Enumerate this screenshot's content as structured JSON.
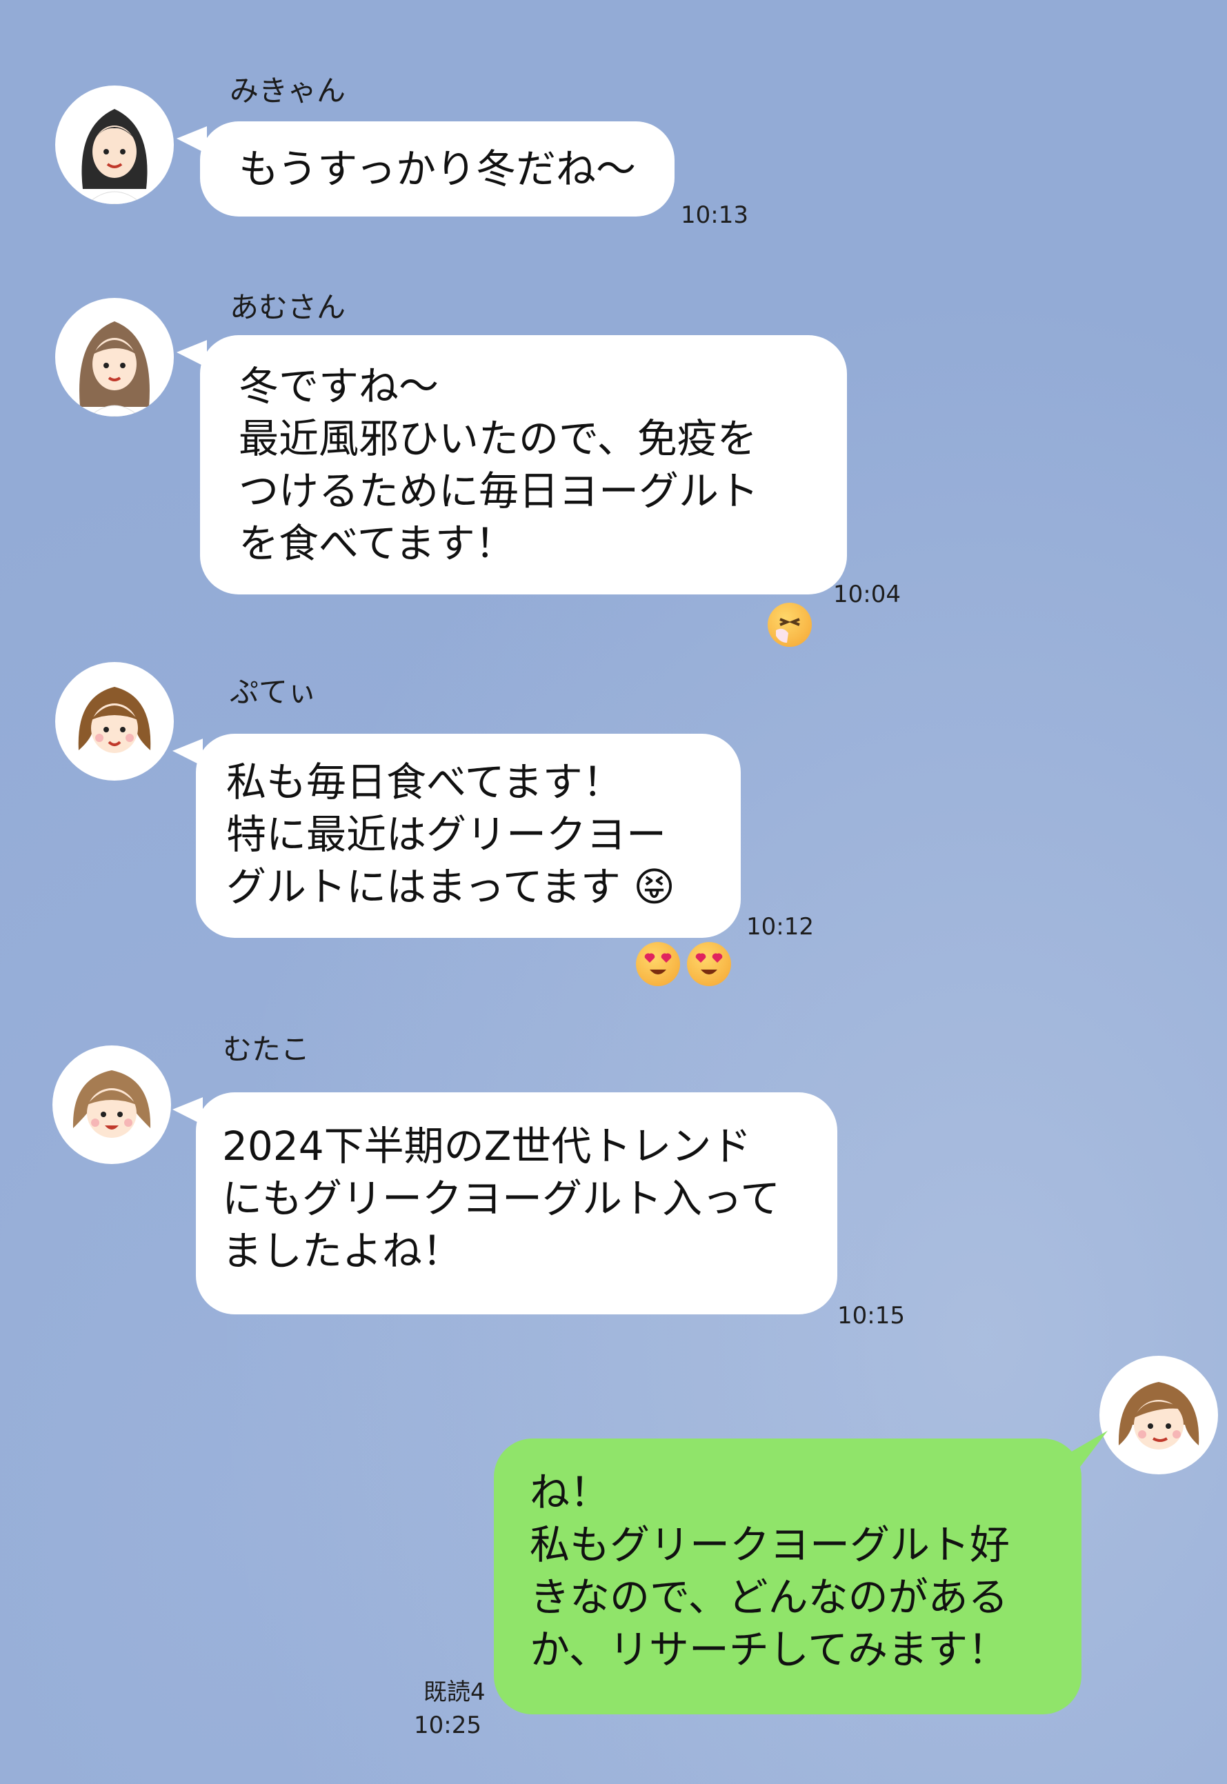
{
  "messages": [
    {
      "sender": "みきゃん",
      "text": "もうすっかり冬だね〜",
      "time": "10:13"
    },
    {
      "sender": "あむさん",
      "text": "冬ですね〜\n最近風邪ひいたので、免疫を\nつけるために毎日ヨーグルト\nを食べてます！",
      "time": "10:04",
      "reaction": "sneezing-face-emoji"
    },
    {
      "sender": "ぷてぃ",
      "text": "私も毎日食べてます！\n特に最近はグリークヨー\nグルトにはまってます 😝",
      "time": "10:12",
      "reaction": "heart-eyes-emoji"
    },
    {
      "sender": "むたこ",
      "text": "2024下半期のZ世代トレンド\nにもグリークヨーグルト入って\nましたよね！",
      "time": "10:15"
    }
  ],
  "my_message": {
    "text": "ね！\n私もグリークヨーグルト好\nきなので、どんなのがある\nか、リサーチしてみます！",
    "read": "既読4",
    "time": "10:25"
  },
  "colors": {
    "background": "#93abd6",
    "my_bubble": "#90e46a",
    "other_bubble": "#ffffff"
  }
}
